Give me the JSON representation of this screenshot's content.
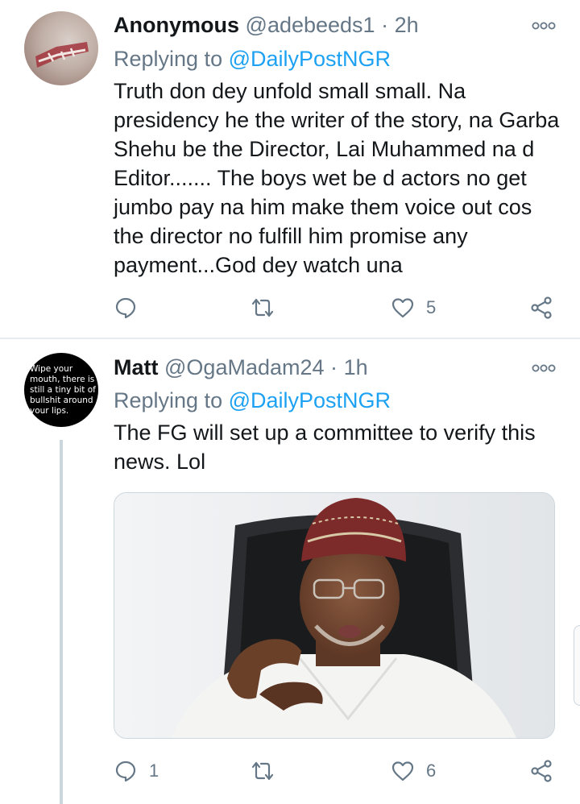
{
  "tweets": [
    {
      "name": "Anonymous",
      "handle": "@adebeeds1",
      "separator": "·",
      "time": "2h",
      "replying_label": "Replying to",
      "replying_to": "@DailyPostNGR",
      "text": "Truth don dey unfold small small. Na presidency he the writer of the story, na Garba Shehu be the Director, Lai Muhammed na d Editor....... The boys wet be d actors no get jumbo pay na him make them voice out cos the director no fulfill him promise any payment...God dey watch una",
      "reply_count": "",
      "retweet_count": "",
      "like_count": "5"
    },
    {
      "name": "Matt",
      "handle": "@OgaMadam24",
      "separator": "·",
      "time": "1h",
      "replying_label": "Replying to",
      "replying_to": "@DailyPostNGR",
      "text": "The FG will set up a committee to verify this news. Lol",
      "avatar_text": "Wipe your mouth, there is still a tiny bit of bullshit around your lips.",
      "reply_count": "1",
      "retweet_count": "",
      "like_count": "6"
    }
  ],
  "icons": {
    "reply": "reply-icon",
    "retweet": "retweet-icon",
    "like": "heart-icon",
    "share": "share-icon",
    "more": "more-icon"
  },
  "colors": {
    "link": "#1da1f2",
    "secondary": "#657786",
    "text": "#14171a"
  }
}
